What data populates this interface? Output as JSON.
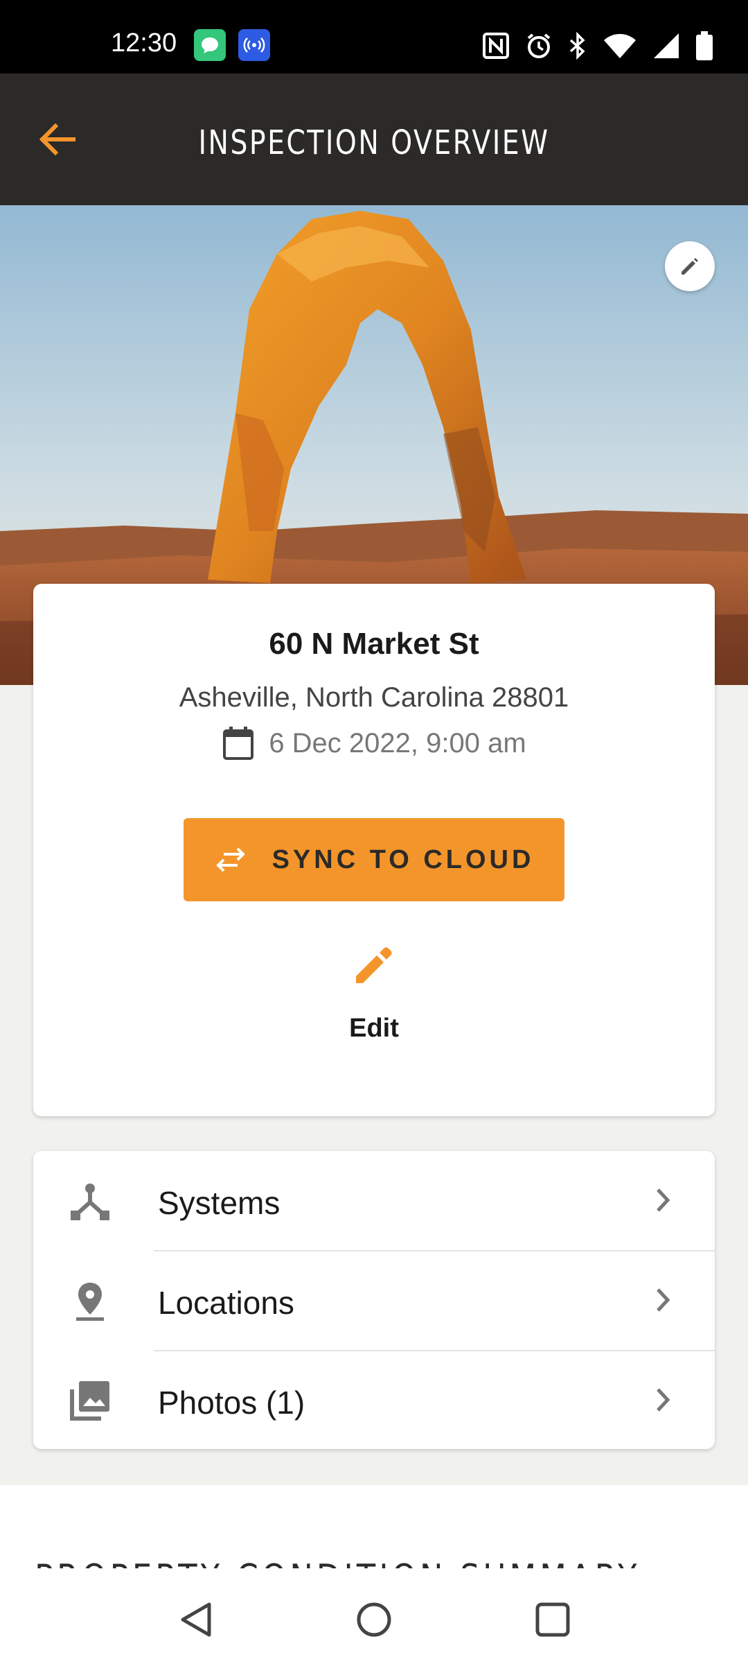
{
  "status_bar": {
    "time": "12:30",
    "icons": [
      "messages-app-icon",
      "broadcast-app-icon",
      "nfc-icon",
      "alarm-icon",
      "bluetooth-icon",
      "wifi-icon",
      "cell-signal-icon",
      "battery-icon"
    ]
  },
  "app_bar": {
    "title": "INSPECTION OVERVIEW",
    "back_icon": "arrow-left-icon"
  },
  "hero": {
    "image": "desert-arch-photo",
    "edit_icon": "pencil-icon"
  },
  "property": {
    "address_line1": "60 N Market St",
    "address_line2": "Asheville, North Carolina 28801",
    "date": "6 Dec 2022, 9:00 am",
    "sync_button_label": "SYNC TO CLOUD",
    "edit_label": "Edit"
  },
  "nav_items": [
    {
      "label": "Systems",
      "icon": "systems-icon"
    },
    {
      "label": "Locations",
      "icon": "location-pin-icon"
    },
    {
      "label": "Photos (1)",
      "icon": "photo-library-icon"
    }
  ],
  "section_title": "PROPERTY CONDITION SUMMARY",
  "colors": {
    "accent": "#f4952b",
    "app_bar": "#2b2a28",
    "background": "#f1f1ee"
  }
}
